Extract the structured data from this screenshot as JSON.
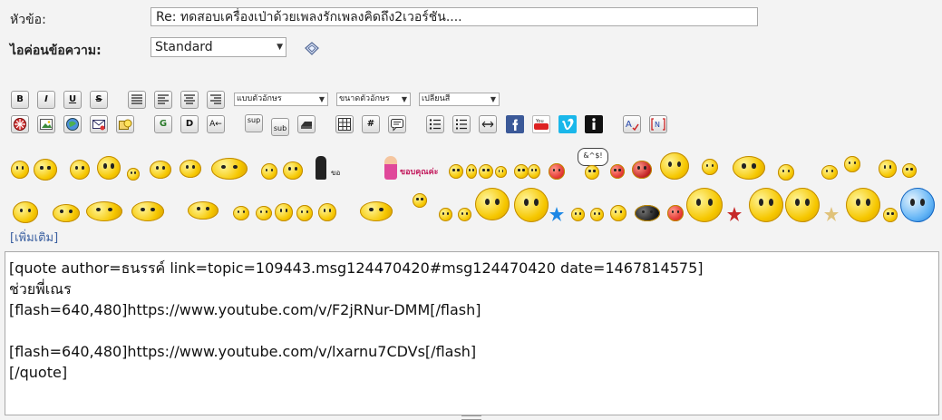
{
  "form": {
    "subject_label": "หัวข้อ:",
    "subject_value": "Re: ทดสอบเครื่องเป่าด้วยเพลงรักเพลงคิดถึง2เวอร์ชัน....",
    "icon_label": "ไอค่อนข้อความ:",
    "icon_value": "Standard"
  },
  "toolbar": {
    "face_select": "แบบตัวอักษร",
    "size_select": "ขนาดตัวอักษร",
    "color_select": "เปลี่ยนสี",
    "bold": "B",
    "italic": "I",
    "underline": "U",
    "strike": "S",
    "sup": "sup",
    "sub": "sub",
    "hash": "#",
    "g": "G",
    "d": "D",
    "ltr": "A←",
    "rtl": "A"
  },
  "smileys": {
    "more_label": "[เพิ่มเติม]",
    "thanks_label": "ขอบคุณค่ะ",
    "sign_label": "ขอ"
  },
  "message": {
    "body": "[quote author=ธนรรค์ link=topic=109443.msg124470420#msg124470420 date=1467814575]\nช่วยพี่เณร\n[flash=640,480]https://www.youtube.com/v/F2jRNur-DMM[/flash]\n\n[flash=640,480]https://www.youtube.com/v/lxarnu7CDVs[/flash]\n[/quote]"
  }
}
